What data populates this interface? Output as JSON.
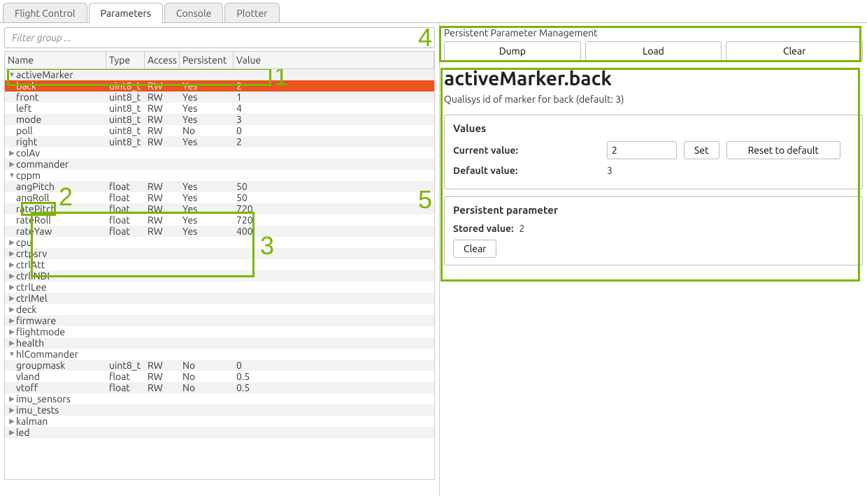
{
  "tabs": [
    "Flight Control",
    "Parameters",
    "Console",
    "Plotter"
  ],
  "active_tab": 1,
  "filter_placeholder": "Filter group ...",
  "columns": [
    "Name",
    "Type",
    "Access",
    "Persistent",
    "Value"
  ],
  "rows": [
    {
      "level": 1,
      "expanded": true,
      "name": "activeMarker",
      "type": "",
      "access": "",
      "persistent": "",
      "value": ""
    },
    {
      "level": 2,
      "name": "back",
      "type": "uint8_t",
      "access": "RW",
      "persistent": "Yes",
      "value": "2",
      "selected": true
    },
    {
      "level": 2,
      "name": "front",
      "type": "uint8_t",
      "access": "RW",
      "persistent": "Yes",
      "value": "1"
    },
    {
      "level": 2,
      "name": "left",
      "type": "uint8_t",
      "access": "RW",
      "persistent": "Yes",
      "value": "4"
    },
    {
      "level": 2,
      "name": "mode",
      "type": "uint8_t",
      "access": "RW",
      "persistent": "Yes",
      "value": "3"
    },
    {
      "level": 2,
      "name": "poll",
      "type": "uint8_t",
      "access": "RW",
      "persistent": "No",
      "value": "0"
    },
    {
      "level": 2,
      "name": "right",
      "type": "uint8_t",
      "access": "RW",
      "persistent": "Yes",
      "value": "2"
    },
    {
      "level": 1,
      "expanded": false,
      "name": "colAv",
      "type": "",
      "access": "",
      "persistent": "",
      "value": ""
    },
    {
      "level": 1,
      "expanded": false,
      "name": "commander",
      "type": "",
      "access": "",
      "persistent": "",
      "value": ""
    },
    {
      "level": 1,
      "expanded": true,
      "name": "cppm",
      "type": "",
      "access": "",
      "persistent": "",
      "value": ""
    },
    {
      "level": 2,
      "name": "angPitch",
      "type": "float",
      "access": "RW",
      "persistent": "Yes",
      "value": "50"
    },
    {
      "level": 2,
      "name": "angRoll",
      "type": "float",
      "access": "RW",
      "persistent": "Yes",
      "value": "50"
    },
    {
      "level": 2,
      "name": "ratePitch",
      "type": "float",
      "access": "RW",
      "persistent": "Yes",
      "value": "720"
    },
    {
      "level": 2,
      "name": "rateRoll",
      "type": "float",
      "access": "RW",
      "persistent": "Yes",
      "value": "720"
    },
    {
      "level": 2,
      "name": "rateYaw",
      "type": "float",
      "access": "RW",
      "persistent": "Yes",
      "value": "400"
    },
    {
      "level": 1,
      "expanded": false,
      "name": "cpu",
      "type": "",
      "access": "",
      "persistent": "",
      "value": ""
    },
    {
      "level": 1,
      "expanded": false,
      "name": "crtpsrv",
      "type": "",
      "access": "",
      "persistent": "",
      "value": ""
    },
    {
      "level": 1,
      "expanded": false,
      "name": "ctrlAtt",
      "type": "",
      "access": "",
      "persistent": "",
      "value": ""
    },
    {
      "level": 1,
      "expanded": false,
      "name": "ctrlINDI",
      "type": "",
      "access": "",
      "persistent": "",
      "value": ""
    },
    {
      "level": 1,
      "expanded": false,
      "name": "ctrlLee",
      "type": "",
      "access": "",
      "persistent": "",
      "value": ""
    },
    {
      "level": 1,
      "expanded": false,
      "name": "ctrlMel",
      "type": "",
      "access": "",
      "persistent": "",
      "value": ""
    },
    {
      "level": 1,
      "expanded": false,
      "name": "deck",
      "type": "",
      "access": "",
      "persistent": "",
      "value": ""
    },
    {
      "level": 1,
      "expanded": false,
      "name": "firmware",
      "type": "",
      "access": "",
      "persistent": "",
      "value": ""
    },
    {
      "level": 1,
      "expanded": false,
      "name": "flightmode",
      "type": "",
      "access": "",
      "persistent": "",
      "value": ""
    },
    {
      "level": 1,
      "expanded": false,
      "name": "health",
      "type": "",
      "access": "",
      "persistent": "",
      "value": ""
    },
    {
      "level": 1,
      "expanded": true,
      "name": "hlCommander",
      "type": "",
      "access": "",
      "persistent": "",
      "value": ""
    },
    {
      "level": 2,
      "name": "groupmask",
      "type": "uint8_t",
      "access": "RW",
      "persistent": "No",
      "value": "0"
    },
    {
      "level": 2,
      "name": "vland",
      "type": "float",
      "access": "RW",
      "persistent": "No",
      "value": "0.5"
    },
    {
      "level": 2,
      "name": "vtoff",
      "type": "float",
      "access": "RW",
      "persistent": "No",
      "value": "0.5"
    },
    {
      "level": 1,
      "expanded": false,
      "name": "imu_sensors",
      "type": "",
      "access": "",
      "persistent": "",
      "value": ""
    },
    {
      "level": 1,
      "expanded": false,
      "name": "imu_tests",
      "type": "",
      "access": "",
      "persistent": "",
      "value": ""
    },
    {
      "level": 1,
      "expanded": false,
      "name": "kalman",
      "type": "",
      "access": "",
      "persistent": "",
      "value": ""
    },
    {
      "level": 1,
      "expanded": false,
      "name": "led",
      "type": "",
      "access": "",
      "persistent": "",
      "value": ""
    }
  ],
  "persist": {
    "title": "Persistent Parameter Management",
    "dump": "Dump",
    "load": "Load",
    "clear": "Clear"
  },
  "param": {
    "full_name": "activeMarker.back",
    "description": "Qualisys id of marker for back (default: 3)",
    "values_heading": "Values",
    "current_label": "Current value:",
    "current_value": "2",
    "set_label": "Set",
    "reset_label": "Reset to default",
    "default_label": "Default value:",
    "default_value": "3",
    "persist_heading": "Persistent parameter",
    "stored_label": "Stored value:",
    "stored_value": "2",
    "clear_label": "Clear"
  },
  "annotations": [
    "1",
    "2",
    "3",
    "4",
    "5"
  ]
}
